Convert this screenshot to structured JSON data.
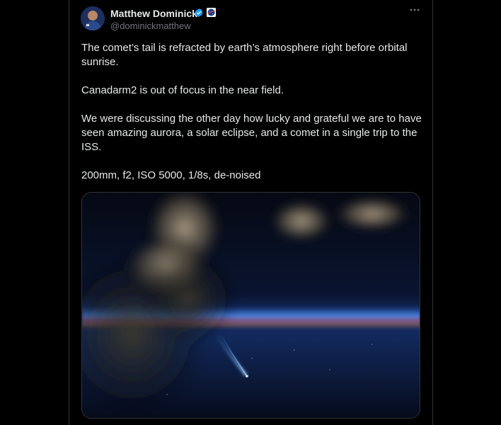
{
  "tweet": {
    "author_name": "Matthew Dominick",
    "handle": "@dominickmatthew",
    "more_icon": "more-horizontal-icon",
    "verified_icon": "verified-badge-icon",
    "affiliation_icon": "nasa-logo-icon",
    "paragraphs": [
      "The comet’s tail is refracted by earth’s atmosphere right before orbital sunrise.",
      "Canadarm2 is out of focus in the near field.",
      "We were discussing the other day how lucky and grateful we are to have seen amazing aurora, a solar eclipse, and a comet in a single trip to the ISS.",
      "200mm, f2, ISO 5000, 1/8s, de-noised"
    ]
  },
  "colors": {
    "background": "#000000",
    "text_primary": "#e7e9ea",
    "text_secondary": "#71767b",
    "verified_blue": "#1d9bf0",
    "border": "#2f3336"
  }
}
